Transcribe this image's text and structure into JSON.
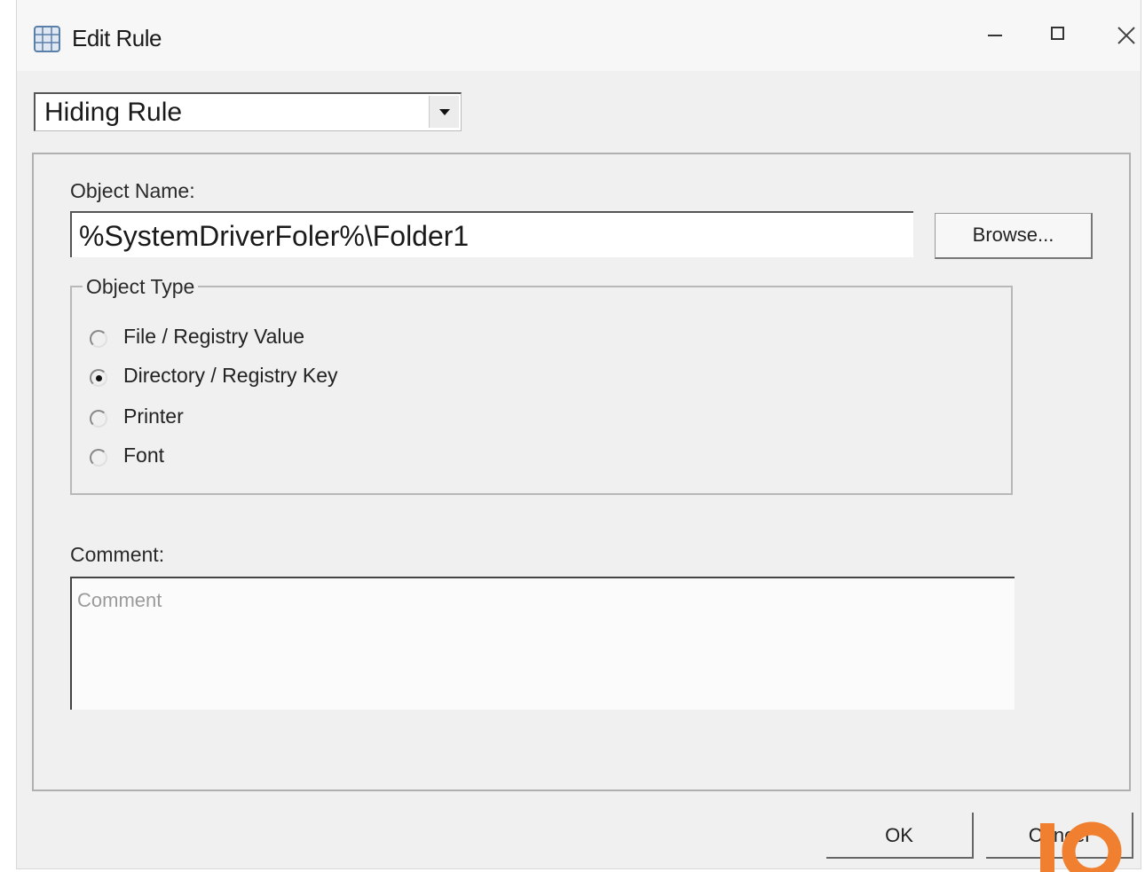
{
  "window": {
    "title": "Edit Rule",
    "icon": "globe-grid-icon",
    "controls": [
      "minimize-icon",
      "maximize-icon",
      "close-icon"
    ]
  },
  "rule_type": {
    "selected": "Hiding Rule"
  },
  "object_name": {
    "label": "Object Name:",
    "value": "%SystemDriverFoler%\\Folder1",
    "browse_label": "Browse..."
  },
  "object_type": {
    "legend": "Object Type",
    "options": [
      {
        "label": "File / Registry Value",
        "checked": false
      },
      {
        "label": "Directory / Registry Key",
        "checked": true
      },
      {
        "label": "Printer",
        "checked": false
      },
      {
        "label": "Font",
        "checked": false
      }
    ]
  },
  "comment": {
    "label": "Comment:",
    "placeholder": "Comment"
  },
  "footer": {
    "ok_label": "OK",
    "cancel_label": "Cancel"
  },
  "colors": {
    "dialog_background": "#f0f0f0",
    "corner_mark": "#f08030"
  }
}
